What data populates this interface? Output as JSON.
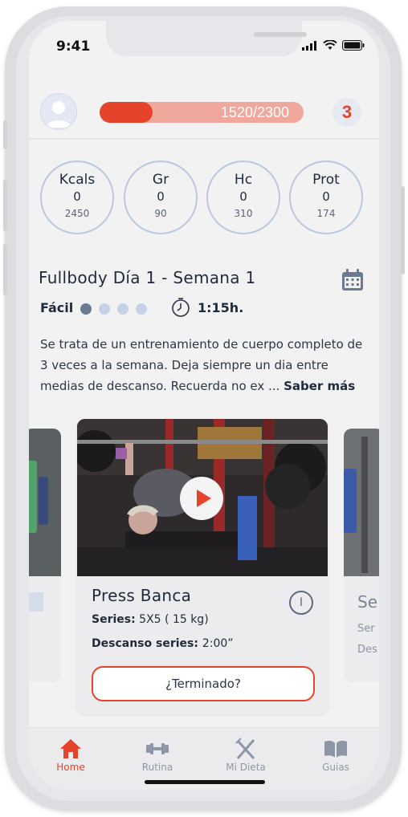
{
  "status_bar": {
    "time": "9:41"
  },
  "header": {
    "progress_text": "1520/2300",
    "progress_fraction": 0.26,
    "badge": "3"
  },
  "macros": [
    {
      "label": "Kcals",
      "value": "0",
      "goal": "2450"
    },
    {
      "label": "Gr",
      "value": "0",
      "goal": "90"
    },
    {
      "label": "Hc",
      "value": "0",
      "goal": "310"
    },
    {
      "label": "Prot",
      "value": "0",
      "goal": "174"
    }
  ],
  "workout": {
    "title": "Fullbody Día 1 - Semana 1",
    "difficulty": "Fácil",
    "difficulty_level": 1,
    "difficulty_max": 4,
    "duration": "1:15h.",
    "description": "Se trata de un entrenamiento de cuerpo completo de 3 veces a la semana. Deja siempre un dia entre medias de descanso. Recuerda no ex ...",
    "more_link": "Saber más"
  },
  "exercise": {
    "name": "Press Banca",
    "series_label": "Series:",
    "series_value": "5X5 ( 15 kg)",
    "rest_label": "Descanso series:",
    "rest_value": "2:00”",
    "done_button": "¿Terminado?",
    "info_icon": "I"
  },
  "next_card": {
    "name_partial": "Se",
    "line1": "Ser",
    "line2": "Des"
  },
  "nav": [
    {
      "label": "Home",
      "icon": "home-icon",
      "active": true
    },
    {
      "label": "Rutina",
      "icon": "dumbbell-icon",
      "active": false
    },
    {
      "label": "Mi Dieta",
      "icon": "cutlery-icon",
      "active": false
    },
    {
      "label": "Guias",
      "icon": "book-icon",
      "active": false
    }
  ],
  "colors": {
    "accent": "#e5432a",
    "accent_light": "#f0a89c",
    "ring": "#b9c8de",
    "text_dark": "#1f2a3c"
  }
}
